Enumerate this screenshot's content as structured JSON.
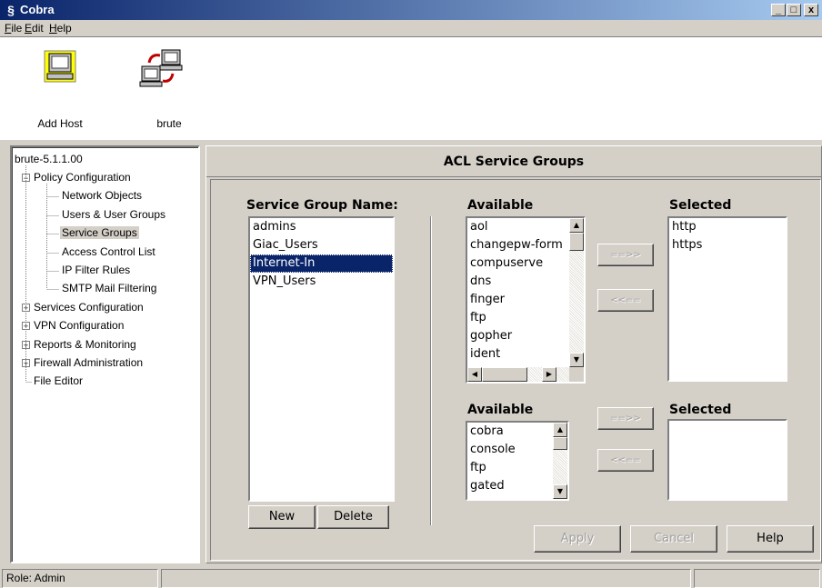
{
  "window": {
    "title": "Cobra",
    "controls": [
      "_",
      "□",
      "x"
    ]
  },
  "menu": [
    {
      "label": "File",
      "underline": "F",
      "rest": "ile"
    },
    {
      "label": "Edit",
      "underline": "E",
      "rest": "dit"
    },
    {
      "label": "Help",
      "underline": "H",
      "rest": "elp"
    }
  ],
  "toolbar": {
    "add_host_label": "Add Host",
    "brute_label": "brute"
  },
  "tree": {
    "root": "brute-5.1.1.00",
    "policy": "Policy Configuration",
    "policy_children": [
      "Network Objects",
      "Users & User Groups",
      "Service Groups",
      "Access Control List",
      "IP Filter Rules",
      "SMTP Mail Filtering"
    ],
    "selected": "Service Groups",
    "others": [
      "Services Configuration",
      "VPN Configuration",
      "Reports & Monitoring",
      "Firewall Administration"
    ],
    "file_editor": "File Editor"
  },
  "panel": {
    "title": "ACL Service Groups",
    "group_name_label": "Service Group Name:",
    "groups": [
      "admins",
      "Giac_Users",
      "Internet-In",
      "VPN_Users"
    ],
    "selected_group": "Internet-In",
    "available_label_1": "Available",
    "available_1": [
      "aol",
      "changepw-form",
      "compuserve",
      "dns",
      "finger",
      "ftp",
      "gopher",
      "ident"
    ],
    "selected_label_1": "Selected",
    "selected_1": [
      "http",
      "https"
    ],
    "available_label_2": "Available",
    "available_2": [
      "cobra",
      "console",
      "ftp",
      "gated"
    ],
    "selected_label_2": "Selected",
    "selected_2": [],
    "add_label": "==>>",
    "remove_label": "<<==",
    "new_label": "New",
    "delete_label": "Delete",
    "apply_label": "Apply",
    "cancel_label": "Cancel",
    "help_label": "Help"
  },
  "status": {
    "role": "Role: Admin"
  }
}
